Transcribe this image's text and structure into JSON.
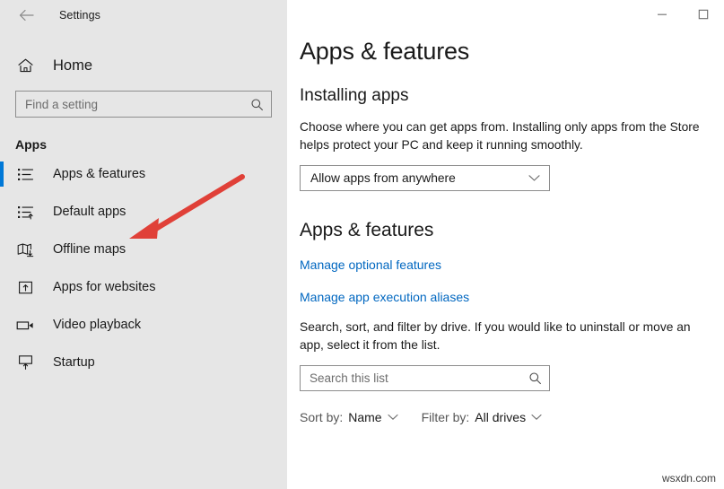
{
  "window": {
    "title": "Settings",
    "back_icon": "back-arrow-icon",
    "controls": [
      {
        "name": "minimize-button",
        "glyph": "—"
      },
      {
        "name": "maximize-button",
        "glyph": "□"
      }
    ]
  },
  "sidebar": {
    "home": {
      "label": "Home",
      "icon": "home-icon"
    },
    "search": {
      "placeholder": "Find a setting",
      "value": "",
      "icon": "search-icon"
    },
    "section_label": "Apps",
    "accent_color": "#0078d7",
    "background": "#e6e6e6",
    "items": [
      {
        "label": "Apps & features",
        "icon": "list-bullets-icon",
        "selected": true
      },
      {
        "label": "Default apps",
        "icon": "list-default-apps-icon",
        "selected": false
      },
      {
        "label": "Offline maps",
        "icon": "map-download-icon",
        "selected": false
      },
      {
        "label": "Apps for websites",
        "icon": "app-website-icon",
        "selected": false
      },
      {
        "label": "Video playback",
        "icon": "video-camera-icon",
        "selected": false
      },
      {
        "label": "Startup",
        "icon": "startup-monitor-icon",
        "selected": false
      }
    ]
  },
  "main": {
    "page_title": "Apps & features",
    "installing_apps": {
      "heading": "Installing apps",
      "description": "Choose where you can get apps from. Installing only apps from the Store helps protect your PC and keep it running smoothly.",
      "dropdown": {
        "value": "Allow apps from anywhere",
        "icon": "chevron-down-icon"
      }
    },
    "apps_features": {
      "heading": "Apps & features",
      "links": [
        "Manage optional features",
        "Manage app execution aliases"
      ],
      "link_color": "#0067c0",
      "description": "Search, sort, and filter by drive. If you would like to uninstall or move an app, select it from the list.",
      "search": {
        "placeholder": "Search this list",
        "value": "",
        "icon": "search-icon"
      },
      "sort_by": {
        "key": "Sort by:",
        "value": "Name",
        "icon": "chevron-down-icon"
      },
      "filter_by": {
        "key": "Filter by:",
        "value": "All drives",
        "icon": "chevron-down-icon"
      }
    }
  },
  "annotation": {
    "arrow": {
      "name": "red-pointer-arrow",
      "color": "#e04038",
      "points_to": "Default apps"
    }
  },
  "watermark": {
    "text": "wsxdn.com"
  }
}
